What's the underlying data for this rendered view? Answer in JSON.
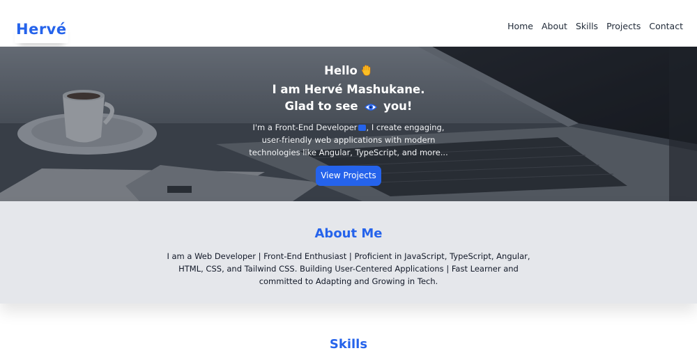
{
  "header": {
    "logo": "Hervé",
    "nav": [
      "Home",
      "About",
      "Skills",
      "Projects",
      "Contact"
    ]
  },
  "hero": {
    "line1": "Hello",
    "line2": "I am Hervé Mashukane.",
    "line3_before": "Glad to see",
    "line3_after": "you!",
    "desc_before": "I'm a Front-End Developer",
    "desc_after": ", I create engaging, user-friendly web applications with modern technologies like Angular, TypeScript, and more...",
    "button": "View Projects",
    "icons": [
      "waving-hand-icon",
      "eye-icon",
      "laptop-icon"
    ]
  },
  "about": {
    "title": "About Me",
    "text": "I am a Web Developer | Front-End Enthusiast | Proficient in JavaScript, TypeScript, Angular, HTML, CSS, and Tailwind CSS. Building User-Centered Applications | Fast Learner and committed to Adapting and Growing in Tech."
  },
  "skills": {
    "title": "Skills"
  },
  "colors": {
    "accent": "#2563eb",
    "about_bg": "#e5e7eb",
    "text_dark": "#1f2937"
  }
}
